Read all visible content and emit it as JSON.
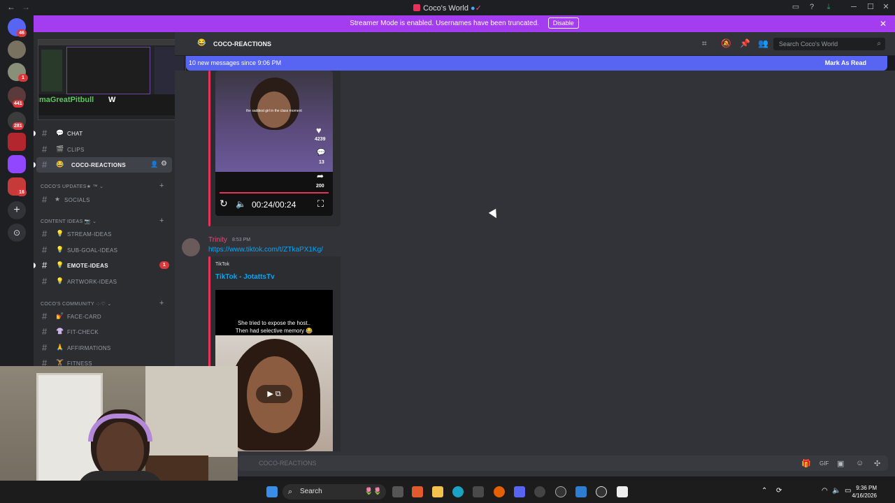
{
  "titlebar": {
    "title": "Coco's World",
    "back": "←",
    "forward": "→"
  },
  "banner": {
    "text": "Streamer Mode is enabled. Usernames have been truncated.",
    "button": "Disable",
    "close": "✕"
  },
  "rail": {
    "badges": [
      "46",
      "1",
      "441",
      "281",
      "16"
    ]
  },
  "preview": {
    "overlay_name": "uisimaGreatPitbull",
    "overlay_letter": "W"
  },
  "sidebar": {
    "channels": [
      {
        "emoji": "💬",
        "label": "CHAT"
      },
      {
        "emoji": "🎬",
        "label": "CLIPS"
      },
      {
        "emoji": "😂",
        "label": "COCO-REACTIONS"
      }
    ],
    "cat_updates": "COCO'S UPDATES★ ™",
    "updates": [
      {
        "emoji": "★",
        "label": "SOCIALS"
      }
    ],
    "cat_content": "CONTENT IDEAS 📷",
    "content": [
      {
        "emoji": "💡",
        "label": "STREAM-IDEAS"
      },
      {
        "emoji": "💡",
        "label": "SUB-GOAL-IDEAS"
      },
      {
        "emoji": "💡",
        "label": "EMOTE-IDEAS",
        "badge": "1"
      },
      {
        "emoji": "💡",
        "label": "ARTWORK-IDEAS"
      }
    ],
    "cat_community": "COCO'S COMMUNITY ·:·♡",
    "community": [
      {
        "emoji": "💅",
        "label": "FACE-CARD"
      },
      {
        "emoji": "👚",
        "label": "FIT-CHECK"
      },
      {
        "emoji": "🙏",
        "label": "AFFIRMATIONS"
      },
      {
        "emoji": "🏋",
        "label": "FITNESS"
      }
    ]
  },
  "header": {
    "channel": "COCO-REACTIONS",
    "search_placeholder": "Search Coco's World"
  },
  "new_messages": {
    "text": "10 new messages since 9:06 PM",
    "mark": "Mark As Read"
  },
  "video1": {
    "likes": "4239",
    "comments": "13",
    "shares": "200",
    "time": "00:24/00:24",
    "caption": "the saddest girl in the class moment"
  },
  "message2": {
    "author": "Trinity",
    "time": "8:53 PM",
    "link": "https://www.tiktok.com/t/ZTkaPX1Kg/",
    "provider": "TikTok",
    "embed_title": "TikTok - JotattsTv",
    "caption": "She tried to expose the host..\nThen had selective memory 😂"
  },
  "chat_input": {
    "placeholder": "COCO-REACTIONS"
  },
  "taskbar": {
    "search": "Search",
    "time": "9:36 PM",
    "date": "4/16/2026"
  },
  "colors": {
    "accent": "#5865f2",
    "banner": "#a43df0",
    "embed": "#e9325b"
  }
}
